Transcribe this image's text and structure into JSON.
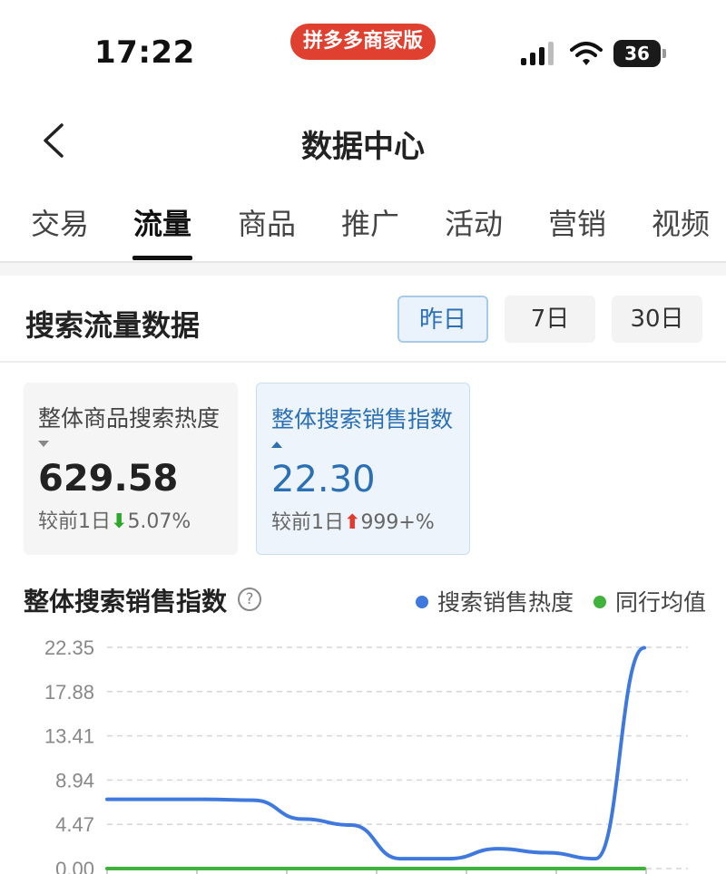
{
  "status_bar": {
    "time": "17:22",
    "app_badge": "拼多多商家版",
    "battery_level": "36",
    "icons": [
      "signal-icon",
      "wifi-icon",
      "battery-icon"
    ]
  },
  "nav": {
    "title": "数据中心",
    "back_icon": "chevron-left-icon"
  },
  "tabs": [
    {
      "label": "交易",
      "active": false
    },
    {
      "label": "流量",
      "active": true
    },
    {
      "label": "商品",
      "active": false
    },
    {
      "label": "推广",
      "active": false
    },
    {
      "label": "活动",
      "active": false
    },
    {
      "label": "营销",
      "active": false
    },
    {
      "label": "视频",
      "active": false
    }
  ],
  "section": {
    "title": "搜索流量数据",
    "ranges": [
      {
        "label": "昨日",
        "selected": true
      },
      {
        "label": "7日",
        "selected": false
      },
      {
        "label": "30日",
        "selected": false
      }
    ]
  },
  "cards": [
    {
      "label": "整体商品搜索热度",
      "value": "629.58",
      "compare_label": "较前1日",
      "trend": "down",
      "arrow": "⬇",
      "change": "5.07%",
      "selected": false
    },
    {
      "label": "整体搜索销售指数",
      "value": "22.30",
      "compare_label": "较前1日",
      "trend": "up",
      "arrow": "⬆",
      "change": "999+%",
      "selected": true
    }
  ],
  "chart_header": {
    "title": "整体搜索销售指数",
    "help": "?",
    "legend": [
      {
        "name": "搜索销售热度",
        "color": "#3f79dd"
      },
      {
        "name": "同行均值",
        "color": "#3eb23a"
      }
    ]
  },
  "colors": {
    "accent_blue": "#2b6fb5",
    "badge_red": "#e0402f",
    "up_red": "#e23b2e",
    "down_green": "#2ea82a"
  },
  "chart_data": {
    "type": "line",
    "title": "整体搜索销售指数",
    "ylim": [
      0,
      22.35
    ],
    "yticks": [
      "22.35",
      "17.88",
      "13.41",
      "8.94",
      "4.47",
      "0.00"
    ],
    "grid": true,
    "legend_position": "top-right",
    "x": [
      0,
      1,
      2,
      3,
      4,
      5,
      6,
      7,
      8,
      9,
      10,
      11
    ],
    "series": [
      {
        "name": "搜索销售热度",
        "color": "#3f79dd",
        "values": [
          7.0,
          7.0,
          7.0,
          6.9,
          5.0,
          4.4,
          1.0,
          1.0,
          2.0,
          1.6,
          1.0,
          22.3
        ]
      },
      {
        "name": "同行均值",
        "color": "#3eb23a",
        "values": [
          0,
          0,
          0,
          0,
          0,
          0,
          0,
          0,
          0,
          0,
          0,
          0
        ]
      }
    ]
  }
}
